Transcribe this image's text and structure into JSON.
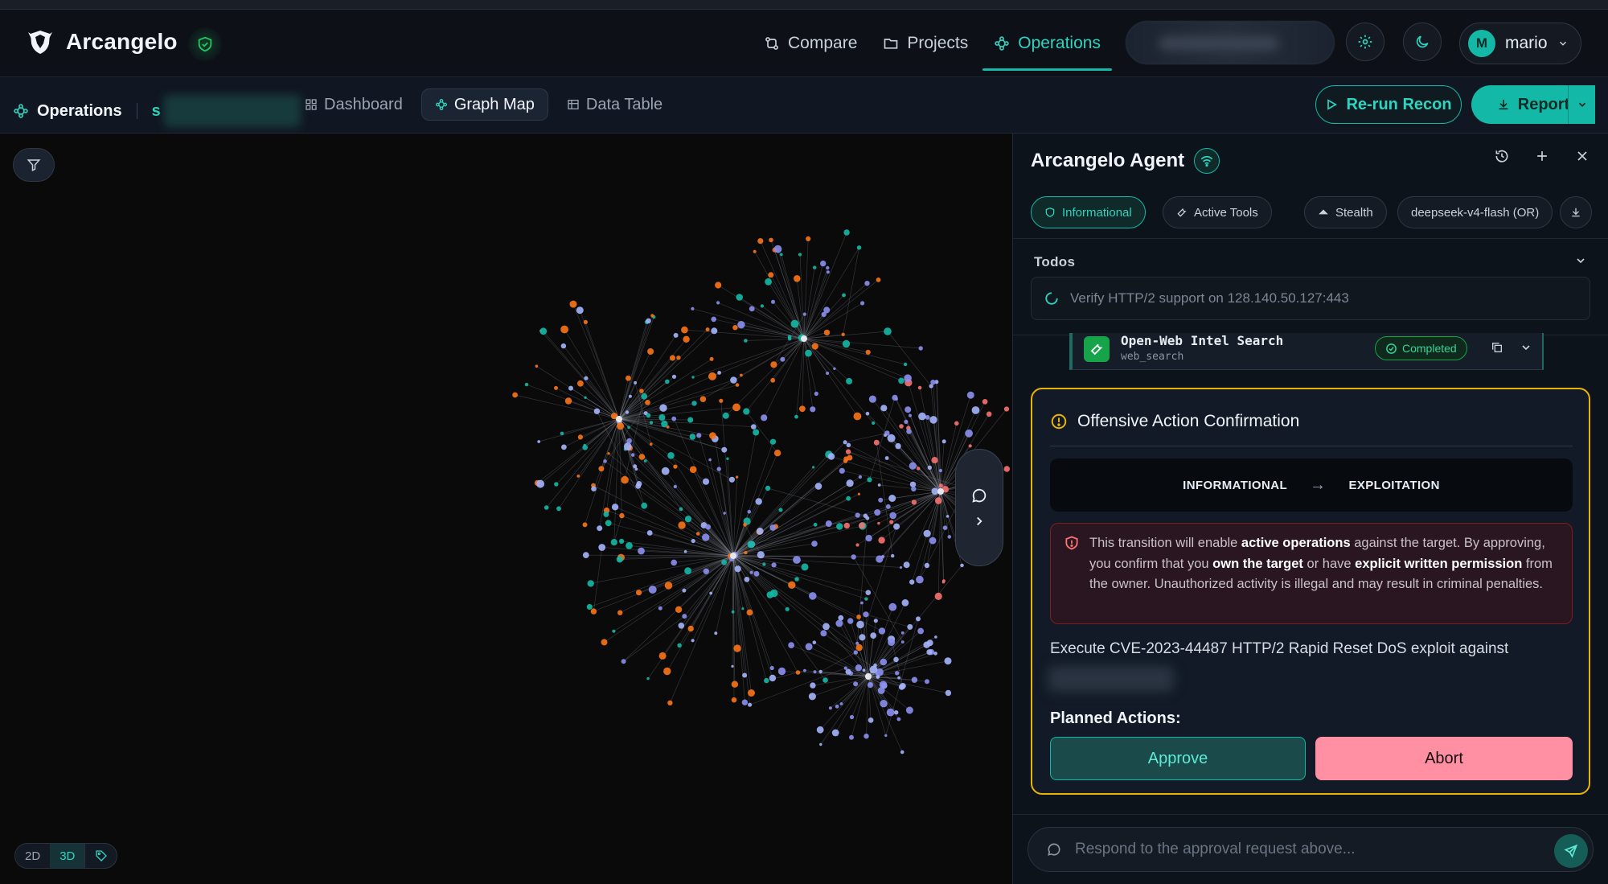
{
  "app": {
    "name": "Arcangelo",
    "colors": {
      "accent": "#14b8a6",
      "warning": "#eab308",
      "danger": "#ff8fa3",
      "success": "#16a34a"
    }
  },
  "topnav": {
    "links": [
      {
        "label": "Compare",
        "icon": "compare-icon"
      },
      {
        "label": "Projects",
        "icon": "folder-icon"
      },
      {
        "label": "Operations",
        "icon": "operations-icon",
        "active": true
      }
    ],
    "user": {
      "initial": "M",
      "name": "mario"
    }
  },
  "subbar": {
    "section": "Operations",
    "section_suffix": "s",
    "tabs": [
      {
        "label": "Dashboard",
        "icon": "grid-icon"
      },
      {
        "label": "Graph Map",
        "icon": "graph-icon",
        "active": true
      },
      {
        "label": "Data Table",
        "icon": "table-icon"
      }
    ],
    "rerun_label": "Re-run Recon",
    "report_label": "Report"
  },
  "graph": {
    "view_modes": [
      "2D",
      "3D"
    ],
    "active_view": "3D"
  },
  "agent": {
    "title": "Arcangelo Agent",
    "chips": {
      "mode": "Informational",
      "tools": "Active Tools",
      "stealth": "Stealth",
      "model": "deepseek-v4-flash (OR)"
    },
    "todos": {
      "label": "Todos",
      "item": "Verify HTTP/2 support on 128.140.50.127:443"
    },
    "tool": {
      "name": "Open-Web Intel Search",
      "id": "web_search",
      "status": "Completed"
    },
    "confirmation": {
      "title": "Offensive Action Confirmation",
      "from_phase": "INFORMATIONAL",
      "arrow": "→",
      "to_phase": "EXPLOITATION",
      "warning": {
        "t1": "This transition will enable ",
        "b1": "active operations",
        "t2": " against the target. By approving, you confirm that you ",
        "b2": "own the target",
        "t3": " or have ",
        "b3": "explicit written permission",
        "t4": " from the owner. Unauthorized activity is illegal and may result in criminal penalties."
      },
      "action": "Execute CVE-2023-44487 HTTP/2 Rapid Reset DoS exploit against",
      "planned_label": "Planned Actions:",
      "approve_label": "Approve",
      "abort_label": "Abort"
    },
    "reply_placeholder": "Respond to the approval request above..."
  }
}
